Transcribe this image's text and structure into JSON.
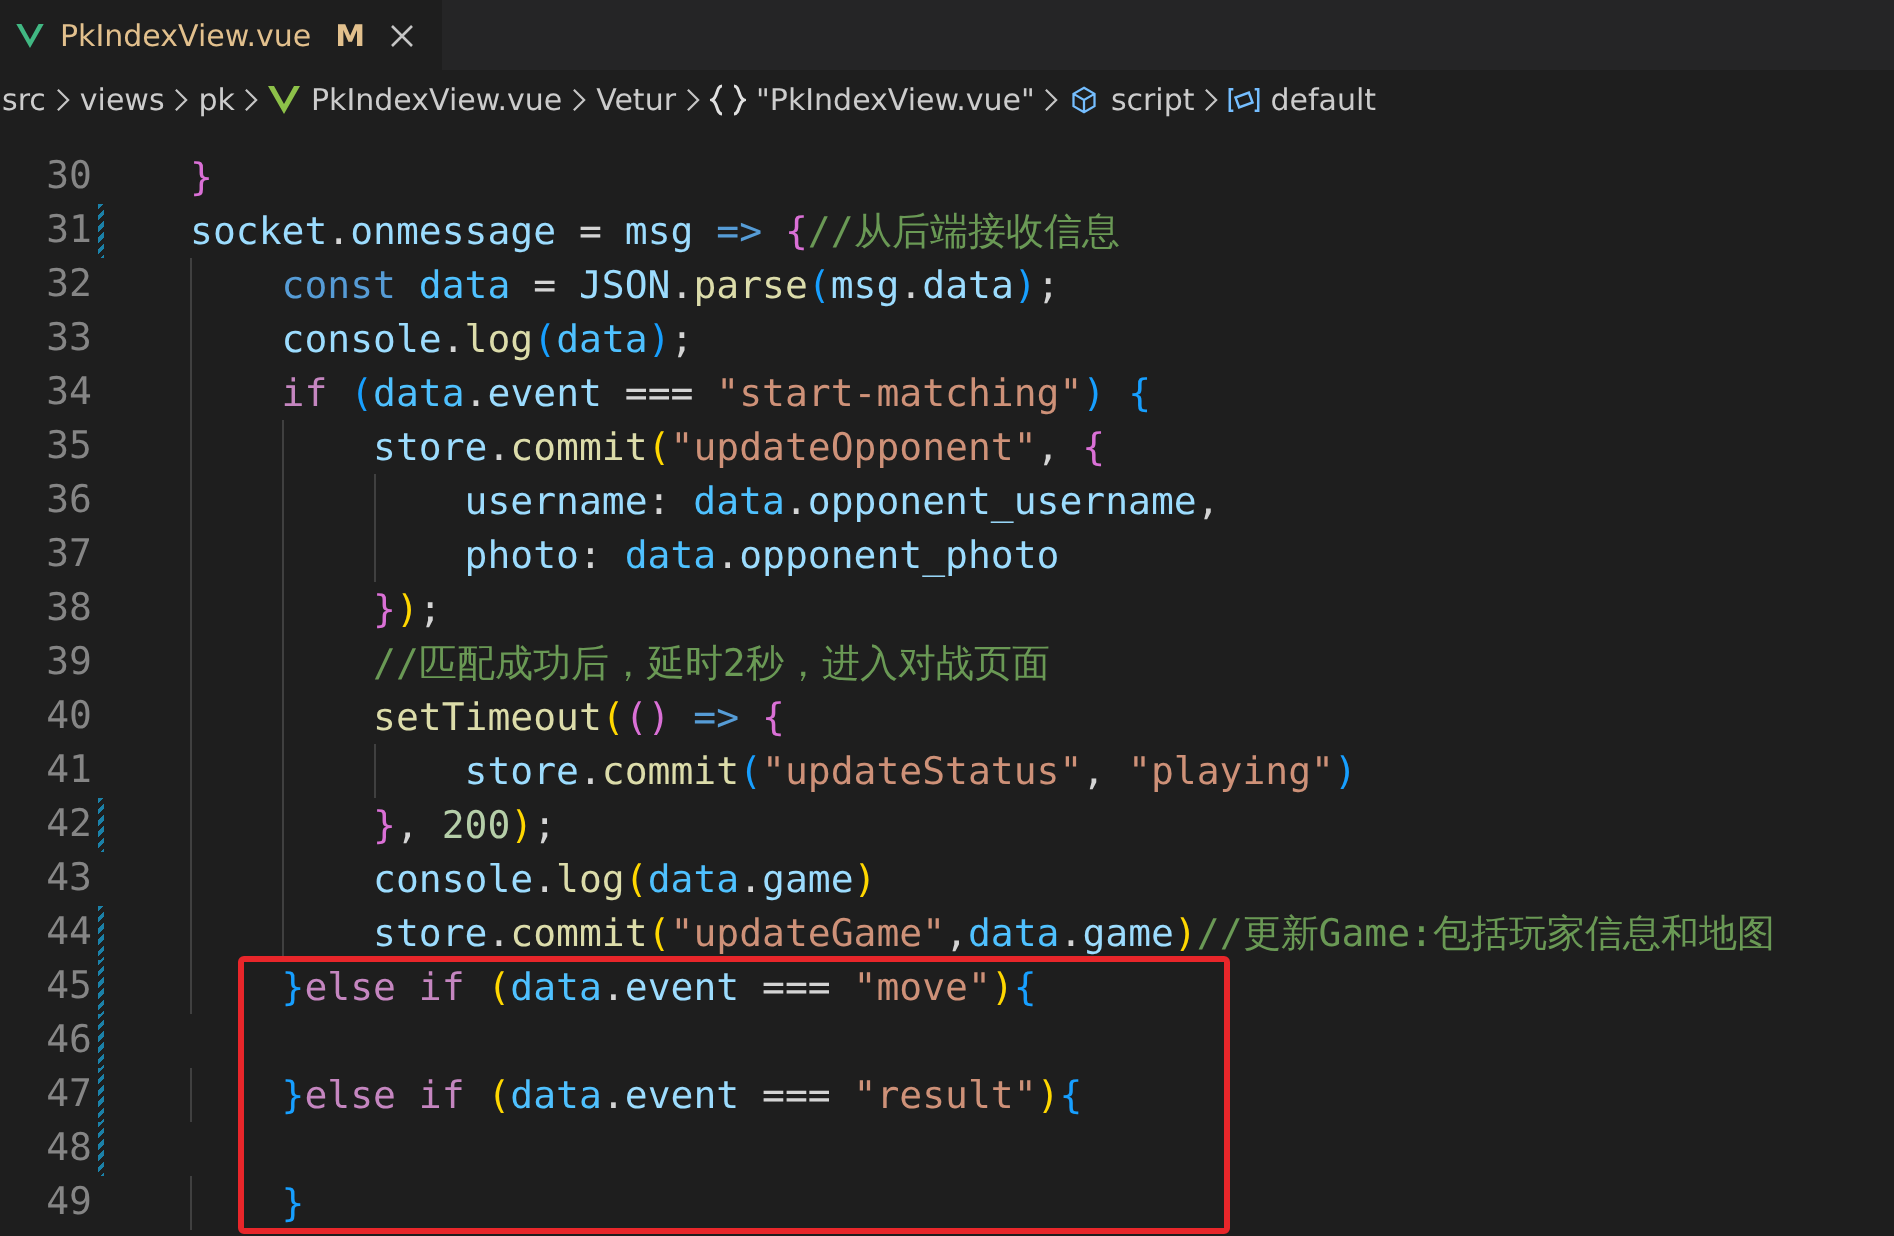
{
  "tab": {
    "title": "PkIndexView.vue",
    "badge": "M",
    "selected": true
  },
  "breadcrumbs": [
    {
      "kind": "folder",
      "text": "src"
    },
    {
      "kind": "folder",
      "text": "views"
    },
    {
      "kind": "folder",
      "text": "pk"
    },
    {
      "kind": "vue-file",
      "text": "PkIndexView.vue"
    },
    {
      "kind": "folder",
      "text": "Vetur"
    },
    {
      "kind": "object",
      "text": "\"PkIndexView.vue\""
    },
    {
      "kind": "module",
      "text": "script"
    },
    {
      "kind": "field",
      "text": "default"
    }
  ],
  "lines": [
    {
      "number": "30",
      "modified": false,
      "tokens": [
        {
          "kind": "b2",
          "text": "}"
        }
      ]
    },
    {
      "number": "31",
      "modified": true,
      "tokens": [
        {
          "kind": "var",
          "text": "socket"
        },
        {
          "kind": "punct",
          "text": "."
        },
        {
          "kind": "var",
          "text": "onmessage"
        },
        {
          "kind": "punct",
          "text": " = "
        },
        {
          "kind": "var",
          "text": "msg "
        },
        {
          "kind": "keyword",
          "text": "=> "
        },
        {
          "kind": "b2",
          "text": "{"
        },
        {
          "kind": "comment",
          "text": "//从后端接收信息"
        }
      ]
    },
    {
      "number": "32",
      "modified": false,
      "tokens": [
        {
          "kind": "keyword",
          "text": "    const "
        },
        {
          "kind": "const",
          "text": "data"
        },
        {
          "kind": "punct",
          "text": " = "
        },
        {
          "kind": "var",
          "text": "JSON"
        },
        {
          "kind": "punct",
          "text": "."
        },
        {
          "kind": "fn",
          "text": "parse"
        },
        {
          "kind": "b3",
          "text": "("
        },
        {
          "kind": "var",
          "text": "msg"
        },
        {
          "kind": "punct",
          "text": "."
        },
        {
          "kind": "var",
          "text": "data"
        },
        {
          "kind": "b3",
          "text": ")"
        },
        {
          "kind": "punct",
          "text": ";"
        }
      ]
    },
    {
      "number": "33",
      "modified": false,
      "tokens": [
        {
          "kind": "var",
          "text": "    console"
        },
        {
          "kind": "punct",
          "text": "."
        },
        {
          "kind": "fn",
          "text": "log"
        },
        {
          "kind": "b3",
          "text": "("
        },
        {
          "kind": "const",
          "text": "data"
        },
        {
          "kind": "b3",
          "text": ")"
        },
        {
          "kind": "punct",
          "text": ";"
        }
      ]
    },
    {
      "number": "34",
      "modified": false,
      "tokens": [
        {
          "kind": "control",
          "text": "    if "
        },
        {
          "kind": "b3",
          "text": "("
        },
        {
          "kind": "const",
          "text": "data"
        },
        {
          "kind": "punct",
          "text": "."
        },
        {
          "kind": "var",
          "text": "event"
        },
        {
          "kind": "punct",
          "text": " === "
        },
        {
          "kind": "string",
          "text": "\"start-matching\""
        },
        {
          "kind": "b3",
          "text": ") {"
        }
      ]
    },
    {
      "number": "35",
      "modified": false,
      "tokens": [
        {
          "kind": "var",
          "text": "        store"
        },
        {
          "kind": "punct",
          "text": "."
        },
        {
          "kind": "fn",
          "text": "commit"
        },
        {
          "kind": "b1",
          "text": "("
        },
        {
          "kind": "string",
          "text": "\"updateOpponent\""
        },
        {
          "kind": "punct",
          "text": ", "
        },
        {
          "kind": "b2",
          "text": "{"
        }
      ]
    },
    {
      "number": "36",
      "modified": false,
      "tokens": [
        {
          "kind": "var",
          "text": "            username"
        },
        {
          "kind": "punct",
          "text": ": "
        },
        {
          "kind": "const",
          "text": "data"
        },
        {
          "kind": "punct",
          "text": "."
        },
        {
          "kind": "var",
          "text": "opponent_username"
        },
        {
          "kind": "punct",
          "text": ","
        }
      ]
    },
    {
      "number": "37",
      "modified": false,
      "tokens": [
        {
          "kind": "var",
          "text": "            photo"
        },
        {
          "kind": "punct",
          "text": ": "
        },
        {
          "kind": "const",
          "text": "data"
        },
        {
          "kind": "punct",
          "text": "."
        },
        {
          "kind": "var",
          "text": "opponent_photo"
        }
      ]
    },
    {
      "number": "38",
      "modified": false,
      "tokens": [
        {
          "kind": "b2",
          "text": "        }"
        },
        {
          "kind": "b1",
          "text": ")"
        },
        {
          "kind": "punct",
          "text": ";"
        }
      ]
    },
    {
      "number": "39",
      "modified": false,
      "tokens": [
        {
          "kind": "comment",
          "text": "        //匹配成功后，延时2秒，进入对战页面"
        }
      ]
    },
    {
      "number": "40",
      "modified": false,
      "tokens": [
        {
          "kind": "fn",
          "text": "        setTimeout"
        },
        {
          "kind": "b1",
          "text": "("
        },
        {
          "kind": "b2",
          "text": "() "
        },
        {
          "kind": "keyword",
          "text": "=> "
        },
        {
          "kind": "b2",
          "text": "{"
        }
      ]
    },
    {
      "number": "41",
      "modified": false,
      "tokens": [
        {
          "kind": "var",
          "text": "            store"
        },
        {
          "kind": "punct",
          "text": "."
        },
        {
          "kind": "fn",
          "text": "commit"
        },
        {
          "kind": "b3",
          "text": "("
        },
        {
          "kind": "string",
          "text": "\"updateStatus\""
        },
        {
          "kind": "punct",
          "text": ", "
        },
        {
          "kind": "string",
          "text": "\"playing\""
        },
        {
          "kind": "b3",
          "text": ")"
        }
      ]
    },
    {
      "number": "42",
      "modified": true,
      "tokens": [
        {
          "kind": "b2",
          "text": "        }"
        },
        {
          "kind": "punct",
          "text": ", "
        },
        {
          "kind": "number",
          "text": "200"
        },
        {
          "kind": "b1",
          "text": ")"
        },
        {
          "kind": "punct",
          "text": ";"
        }
      ]
    },
    {
      "number": "43",
      "modified": false,
      "tokens": [
        {
          "kind": "var",
          "text": "        console"
        },
        {
          "kind": "punct",
          "text": "."
        },
        {
          "kind": "fn",
          "text": "log"
        },
        {
          "kind": "b1",
          "text": "("
        },
        {
          "kind": "const",
          "text": "data"
        },
        {
          "kind": "punct",
          "text": "."
        },
        {
          "kind": "var",
          "text": "game"
        },
        {
          "kind": "b1",
          "text": ")"
        }
      ]
    },
    {
      "number": "44",
      "modified": true,
      "tokens": [
        {
          "kind": "var",
          "text": "        store"
        },
        {
          "kind": "punct",
          "text": "."
        },
        {
          "kind": "fn",
          "text": "commit"
        },
        {
          "kind": "b1",
          "text": "("
        },
        {
          "kind": "string",
          "text": "\"updateGame\""
        },
        {
          "kind": "punct",
          "text": ","
        },
        {
          "kind": "const",
          "text": "data"
        },
        {
          "kind": "punct",
          "text": "."
        },
        {
          "kind": "var",
          "text": "game"
        },
        {
          "kind": "b1",
          "text": ")"
        },
        {
          "kind": "comment",
          "text": "//更新Game:包括玩家信息和地图"
        }
      ]
    },
    {
      "number": "45",
      "modified": true,
      "tokens": [
        {
          "kind": "b3",
          "text": "    }"
        },
        {
          "kind": "control",
          "text": "else if "
        },
        {
          "kind": "b1",
          "text": "("
        },
        {
          "kind": "const",
          "text": "data"
        },
        {
          "kind": "punct",
          "text": "."
        },
        {
          "kind": "var",
          "text": "event"
        },
        {
          "kind": "punct",
          "text": " === "
        },
        {
          "kind": "string",
          "text": "\"move\""
        },
        {
          "kind": "b1",
          "text": ")"
        },
        {
          "kind": "b3",
          "text": "{"
        }
      ]
    },
    {
      "number": "46",
      "modified": true
    },
    {
      "number": "47",
      "modified": true,
      "tokens": [
        {
          "kind": "b3",
          "text": "    }"
        },
        {
          "kind": "control",
          "text": "else if "
        },
        {
          "kind": "b1",
          "text": "("
        },
        {
          "kind": "const",
          "text": "data"
        },
        {
          "kind": "punct",
          "text": "."
        },
        {
          "kind": "var",
          "text": "event"
        },
        {
          "kind": "punct",
          "text": " === "
        },
        {
          "kind": "string",
          "text": "\"result\""
        },
        {
          "kind": "b1",
          "text": ")"
        },
        {
          "kind": "b3",
          "text": "{"
        }
      ]
    },
    {
      "number": "48",
      "modified": true
    },
    {
      "number": "49",
      "modified": false,
      "tokens": [
        {
          "kind": "b3",
          "text": "    }"
        }
      ]
    }
  ]
}
